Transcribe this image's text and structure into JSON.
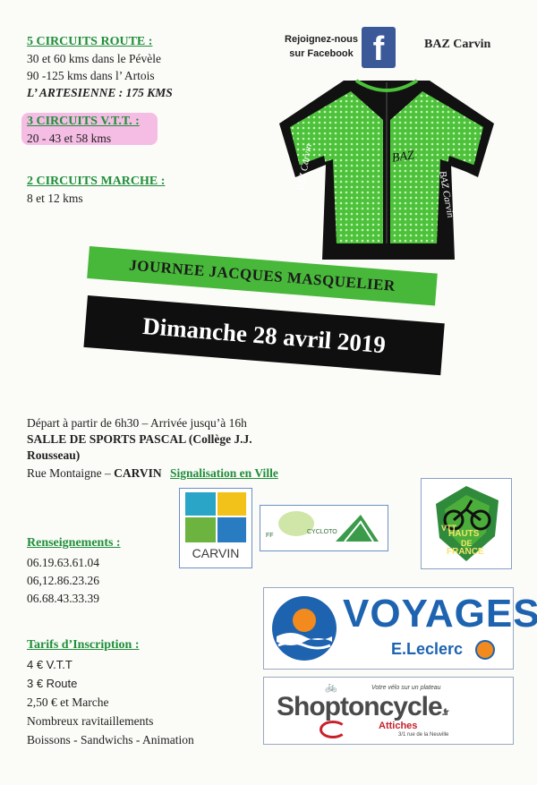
{
  "facebook": {
    "text_line1": "Rejoignez-nous",
    "text_line2": "sur Facebook",
    "icon": "facebook-icon"
  },
  "club_name": "BAZ Carvin",
  "jersey": {
    "chest_text": "BAZ",
    "sleeve_text_left": "BAZ Carvin",
    "sleeve_text_right": "BAZ Carvin",
    "colors": {
      "green": "#4cc23a",
      "black": "#111111"
    }
  },
  "circuits": {
    "route_title": "5 CIRCUITS ROUTE :",
    "route_line1": "30 et 60 kms dans le Pévèle",
    "route_line2": "90 -125 kms dans l’ Artois",
    "route_line3": "L’ ARTESIENNE : 175 KMS",
    "vtt_title": "3 CIRCUITS V.T.T. :",
    "vtt_line1": "20 - 43 et 58 kms",
    "marche_title": "2 CIRCUITS MARCHE :",
    "marche_line1": "8 et 12 kms"
  },
  "event": {
    "name": "JOURNEE JACQUES MASQUELIER",
    "date": "Dimanche 28 avril 2019"
  },
  "venue": {
    "line1": "Départ à partir de 6h30 – Arrivée jusqu’à 16h",
    "line2": "SALLE DE SPORTS PASCAL (Collège J.J.",
    "line3": "Rousseau)",
    "line4_a": "Rue Montaigne – ",
    "line4_b": "CARVIN",
    "line4_c": "Signalisation en Ville"
  },
  "contact": {
    "title": "Renseignements :",
    "phones": [
      "06.19.63.61.04",
      "06,12.86.23.26",
      "06.68.43.33.39"
    ]
  },
  "tarifs": {
    "title": "Tarifs d’Inscription :",
    "lines": [
      "4 € V.T.T",
      "3 € Route",
      "2,50 €  et Marche",
      "Nombreux ravitaillements",
      "Boissons - Sandwichs - Animation"
    ]
  },
  "logos": {
    "carvin": "CARVIN",
    "ffct_small1": "FF",
    "ffct_small2": "CYCLOTO",
    "hauts_line1": "HAUTS",
    "hauts_line2": "DE",
    "hauts_line3": "FRANCE",
    "hauts_vtt": "VTT",
    "voyages": "VOYAGES",
    "leclerc": "E.Leclerc",
    "shop_name": "Shoptoncycle",
    "shop_suffix": ".fr",
    "shop_tagline": "Votre vélo sur un plateau",
    "shop_city": "Attiches",
    "shop_address": "3/1 rue de la Neuville"
  }
}
